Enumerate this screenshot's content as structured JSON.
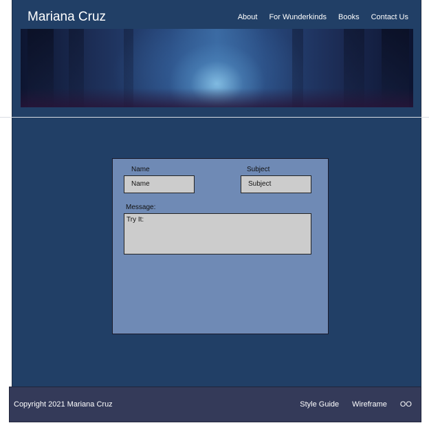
{
  "header": {
    "site_title": "Mariana Cruz",
    "nav": [
      "About",
      "For Wunderkinds",
      "Books",
      "Contact Us"
    ]
  },
  "banner": {
    "description_icon": "forest-banner-image"
  },
  "contact_form": {
    "name_label": "Name",
    "name_placeholder": "Name",
    "subject_label": "Subject",
    "subject_placeholder": "Subject",
    "message_label": "Message:",
    "message_placeholder": "Try It:"
  },
  "footer": {
    "copyright": "Copyright 2021 Mariana Cruz",
    "links": [
      "Style Guide",
      "Wireframe",
      "OO"
    ]
  },
  "colors": {
    "header_bg": "#213f66",
    "form_panel_bg": "#6f8ab5",
    "field_bg": "#cccccc",
    "footer_bg": "#343a59"
  }
}
